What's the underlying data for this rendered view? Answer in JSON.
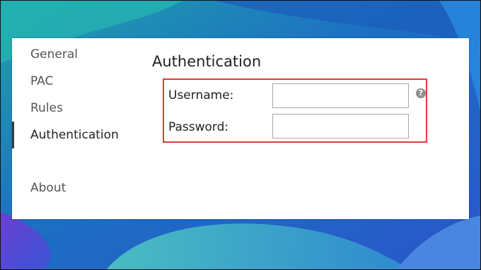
{
  "sidebar": {
    "items": [
      {
        "label": "General"
      },
      {
        "label": "PAC"
      },
      {
        "label": "Rules"
      },
      {
        "label": "Authentication"
      },
      {
        "label": "About"
      }
    ],
    "active": "Authentication"
  },
  "main": {
    "title": "Authentication",
    "fields": {
      "username": {
        "label": "Username:",
        "value": ""
      },
      "password": {
        "label": "Password:",
        "value": ""
      }
    },
    "help_icon": {
      "glyph": "?",
      "icon": "help-icon"
    }
  },
  "colors": {
    "highlight_border": "#e23b3b",
    "window_bg": "#ffffff",
    "wallpaper_base": "#1c6fc0"
  }
}
